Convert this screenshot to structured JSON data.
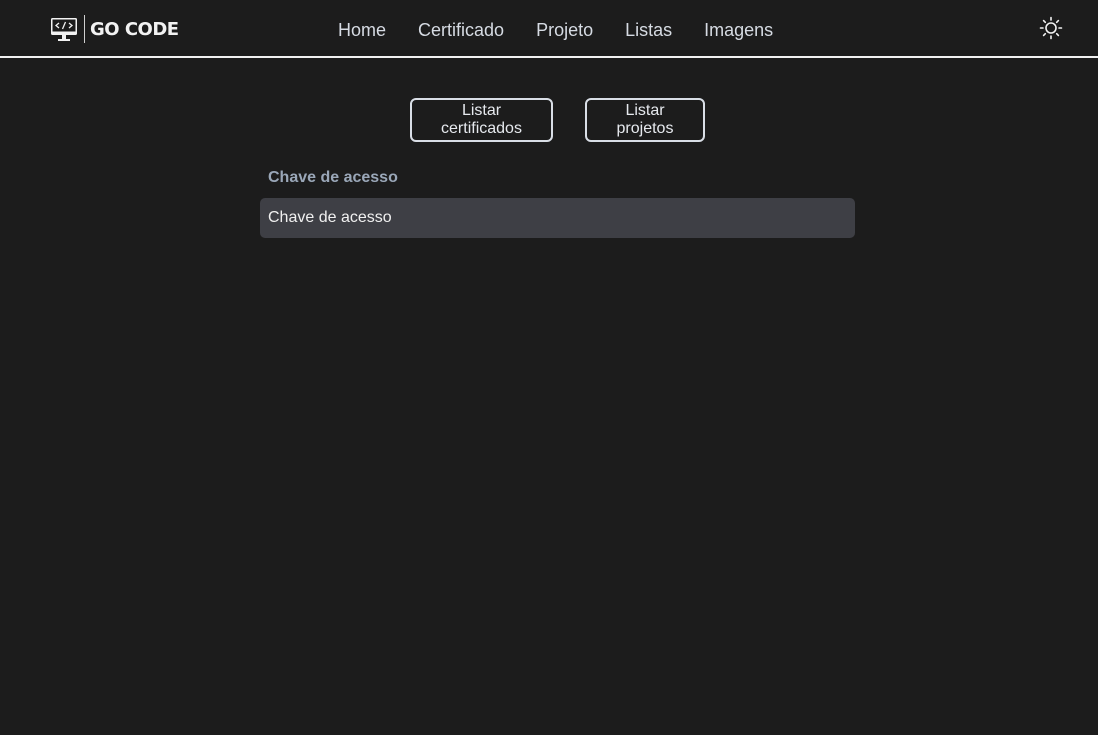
{
  "brand": {
    "name": "GO CODE",
    "icon": "monitor-code-icon"
  },
  "nav": {
    "items": [
      {
        "label": "Home"
      },
      {
        "label": "Certificado"
      },
      {
        "label": "Projeto"
      },
      {
        "label": "Listas"
      },
      {
        "label": "Imagens"
      }
    ],
    "theme_icon": "sun-icon"
  },
  "actions": {
    "list_certificates": "Listar certificados",
    "list_projects": "Listar projetos"
  },
  "access_key": {
    "label": "Chave de acesso",
    "placeholder": "Chave de acesso",
    "value": ""
  },
  "colors": {
    "background": "#1c1c1c",
    "input_background": "#3e3f45",
    "label": "#9aa7b8",
    "border": "#d9dee6"
  }
}
